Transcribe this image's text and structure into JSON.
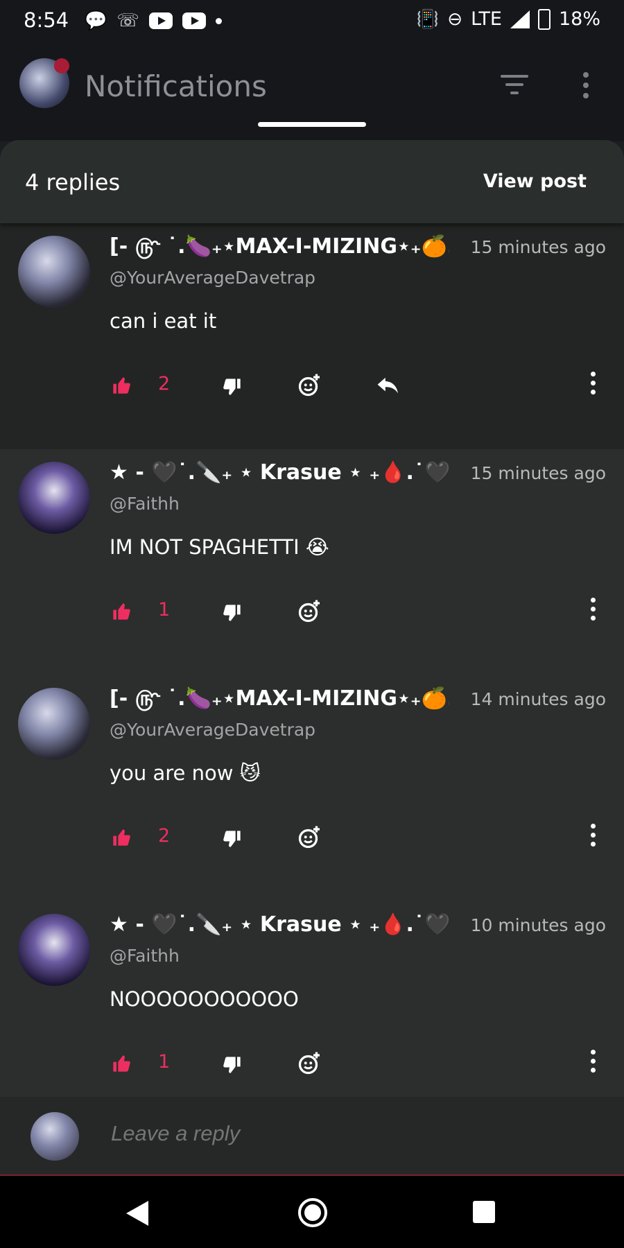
{
  "status_bar": {
    "time": "8:54",
    "network": "LTE",
    "battery": "18%",
    "icons": [
      "chat-bubble-icon",
      "missed-call-icon",
      "youtube-icon",
      "youtube-icon",
      "dot-icon",
      "vibrate-icon",
      "do-not-disturb-icon",
      "signal-icon",
      "battery-charging-icon"
    ]
  },
  "app_bar": {
    "title": "Notifications",
    "icons": [
      "filter-icon",
      "more-vert-icon"
    ]
  },
  "sheet": {
    "header": {
      "replies_count": "4 replies",
      "view_post_label": "View post"
    },
    "comments": [
      {
        "name": "[- ௹ ˙.🍆₊⋆MAX-I-MIZING⋆₊🍊.˙",
        "handle": "@YourAverageDavetrap",
        "time": "15 minutes ago",
        "text": "can i eat it",
        "likes": "2",
        "has_reply": true
      },
      {
        "name": "★ - 🖤˙.🔪₊ ⋆ Krasue ⋆ ₊🩸.˙🖤",
        "handle": "@Faithh",
        "time": "15 minutes ago",
        "text": "IM NOT SPAGHETTI 😭",
        "likes": "1",
        "has_reply": false
      },
      {
        "name": "[- ௹ ˙.🍆₊⋆MAX-I-MIZING⋆₊🍊.˙",
        "handle": "@YourAverageDavetrap",
        "time": "14 minutes ago",
        "text": "you are now 😼",
        "likes": "2",
        "has_reply": false
      },
      {
        "name": "★ - 🖤˙.🔪₊ ⋆ Krasue ⋆ ₊🩸.˙🖤",
        "handle": "@Faithh",
        "time": "10 minutes ago",
        "text": "NOOOOOOOOOOO",
        "likes": "1",
        "has_reply": false
      }
    ]
  },
  "reply_bar": {
    "placeholder": "Leave a reply"
  },
  "nav_bar": {
    "icons": [
      "back-icon",
      "home-icon",
      "recent-apps-icon"
    ]
  },
  "colors": {
    "accent": "#ee2e61",
    "sheet_bg": "#2b2e2c",
    "app_bg": "#16171b"
  }
}
